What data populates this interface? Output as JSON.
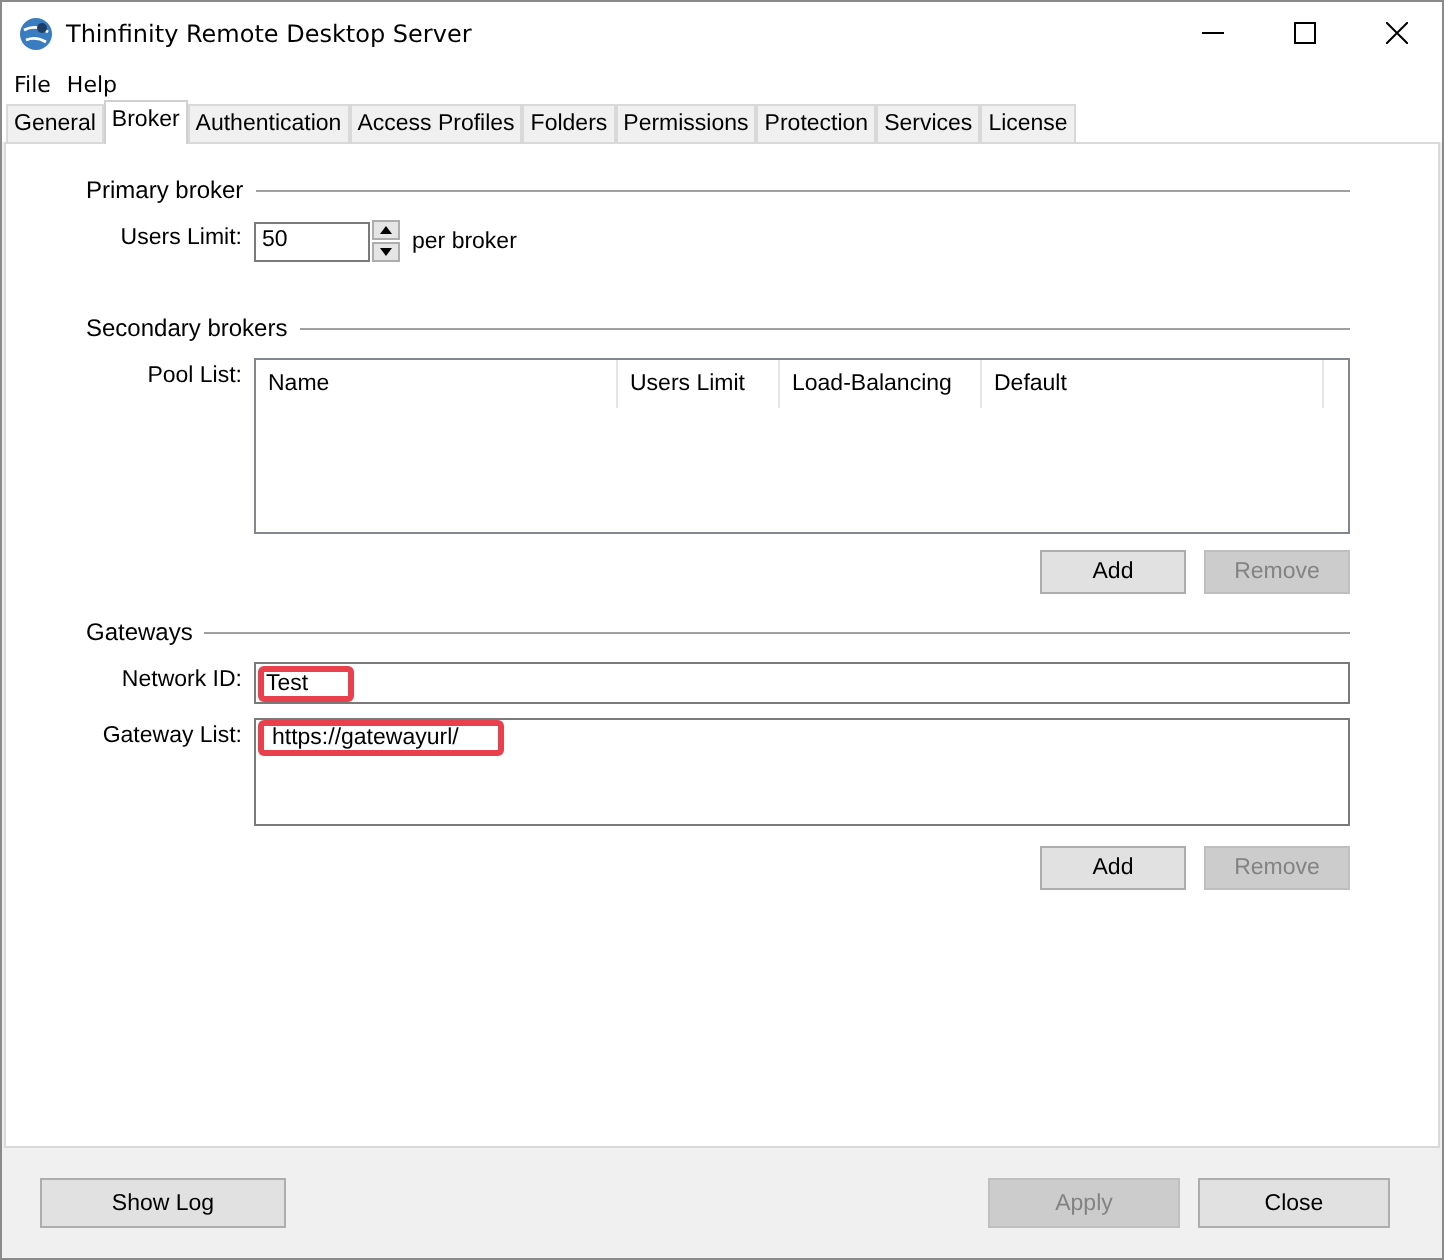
{
  "window": {
    "title": "Thinfinity Remote Desktop Server"
  },
  "menu": [
    "File",
    "Help"
  ],
  "tabs": [
    {
      "label": "General",
      "selected": false
    },
    {
      "label": "Broker",
      "selected": true
    },
    {
      "label": "Authentication",
      "selected": false
    },
    {
      "label": "Access Profiles",
      "selected": false
    },
    {
      "label": "Folders",
      "selected": false
    },
    {
      "label": "Permissions",
      "selected": false
    },
    {
      "label": "Protection",
      "selected": false
    },
    {
      "label": "Services",
      "selected": false
    },
    {
      "label": "License",
      "selected": false
    }
  ],
  "primary_broker": {
    "title": "Primary broker",
    "users_limit_label": "Users Limit:",
    "users_limit": "50",
    "suffix": "per broker"
  },
  "secondary_brokers": {
    "title": "Secondary brokers",
    "pool_list_label": "Pool List:",
    "columns": [
      "Name",
      "Users Limit",
      "Load-Balancing",
      "Default"
    ],
    "buttons": [
      {
        "label": "Add",
        "disabled": false
      },
      {
        "label": "Remove",
        "disabled": true
      }
    ]
  },
  "gateways": {
    "title": "Gateways",
    "network_id_label": "Network ID:",
    "network_id": {
      "value": "Test",
      "highlighted": true
    },
    "gateway_list_label": "Gateway List:",
    "gateway_list": [
      {
        "value": "https://gatewayurl/",
        "highlighted": true
      }
    ],
    "buttons": [
      {
        "label": "Add",
        "disabled": false
      },
      {
        "label": "Remove",
        "disabled": true
      }
    ]
  },
  "footer": {
    "left_buttons": [
      {
        "label": "Show Log",
        "disabled": false
      }
    ],
    "right_buttons": [
      {
        "label": "Apply",
        "disabled": true
      },
      {
        "label": "Close",
        "disabled": false
      }
    ]
  }
}
